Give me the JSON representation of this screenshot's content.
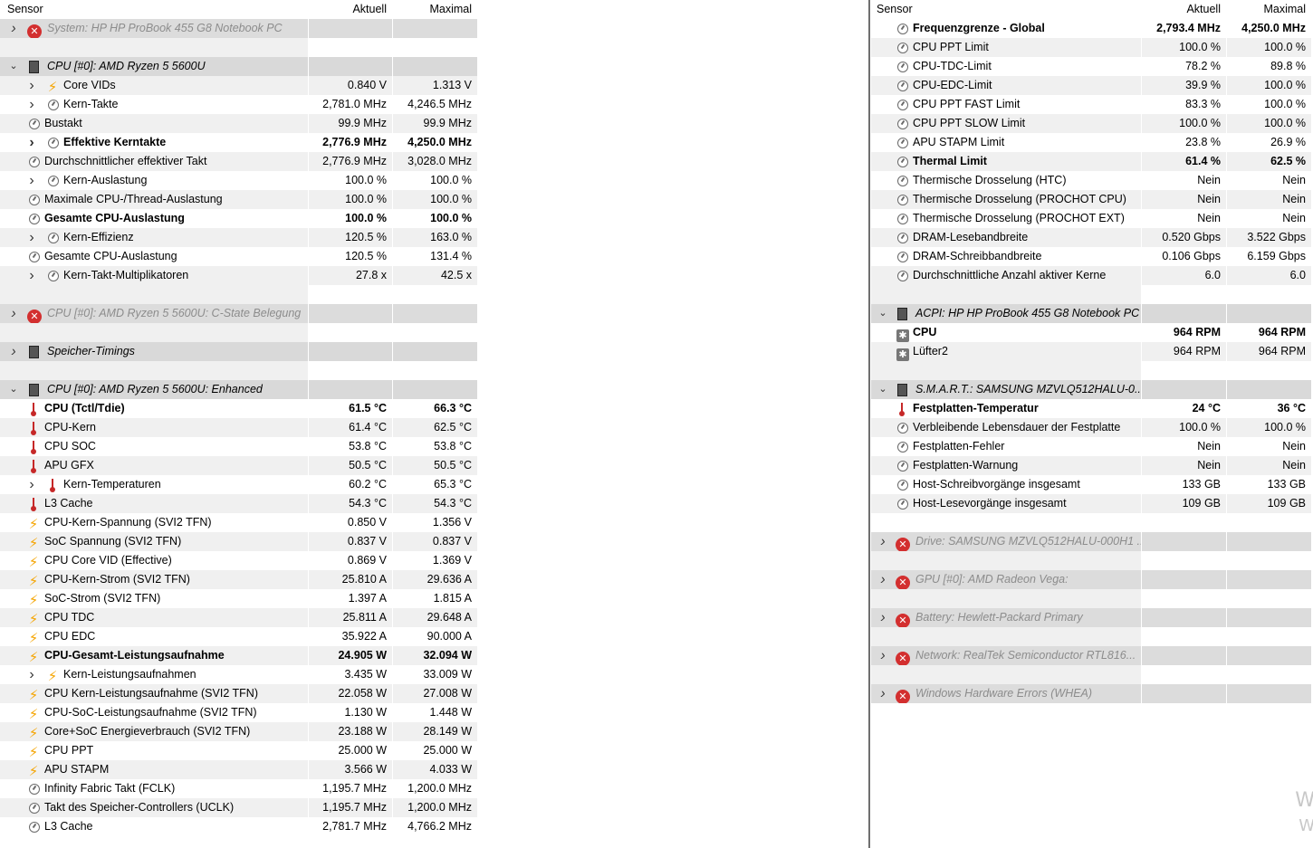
{
  "headers": {
    "sensor": "Sensor",
    "current": "Aktuell",
    "max": "Maximal"
  },
  "colors": {
    "group_bg": "#d9d9d9",
    "alt_bg": "#f0f0f0",
    "error": "#d32f2f",
    "bolt": "#f5a400",
    "therm": "#c62828"
  },
  "left_rows": [
    {
      "kind": "group",
      "err": true,
      "arrow": "right",
      "icon": "error-icon",
      "label": "System: HP HP ProBook 455 G8 Notebook PC"
    },
    {
      "kind": "blank"
    },
    {
      "kind": "group",
      "arrow": "down",
      "icon": "chip-icon",
      "label": "CPU [#0]: AMD Ryzen 5 5600U"
    },
    {
      "kind": "item",
      "indent": 2,
      "arrow": "right",
      "icon": "bolt-icon",
      "label": "Core VIDs",
      "cur": "0.840 V",
      "max": "1.313 V"
    },
    {
      "kind": "item",
      "indent": 2,
      "arrow": "right",
      "icon": "gauge-icon",
      "label": "Kern-Takte",
      "cur": "2,781.0 MHz",
      "max": "4,246.5 MHz"
    },
    {
      "kind": "item",
      "indent": 1,
      "icon": "gauge-icon",
      "label": "Bustakt",
      "cur": "99.9 MHz",
      "max": "99.9 MHz"
    },
    {
      "kind": "item",
      "indent": 2,
      "arrow": "right",
      "icon": "gauge-icon",
      "label": "Effektive Kerntakte",
      "cur": "2,776.9 MHz",
      "max": "4,250.0 MHz",
      "bold": true
    },
    {
      "kind": "item",
      "indent": 1,
      "icon": "gauge-icon",
      "label": "Durchschnittlicher effektiver Takt",
      "cur": "2,776.9 MHz",
      "max": "3,028.0 MHz"
    },
    {
      "kind": "item",
      "indent": 2,
      "arrow": "right",
      "icon": "gauge-icon",
      "label": "Kern-Auslastung",
      "cur": "100.0 %",
      "max": "100.0 %"
    },
    {
      "kind": "item",
      "indent": 1,
      "icon": "gauge-icon",
      "label": "Maximale CPU-/Thread-Auslastung",
      "cur": "100.0 %",
      "max": "100.0 %"
    },
    {
      "kind": "item",
      "indent": 1,
      "icon": "gauge-icon",
      "label": "Gesamte CPU-Auslastung",
      "cur": "100.0 %",
      "max": "100.0 %",
      "bold": true
    },
    {
      "kind": "item",
      "indent": 2,
      "arrow": "right",
      "icon": "gauge-icon",
      "label": "Kern-Effizienz",
      "cur": "120.5 %",
      "max": "163.0 %"
    },
    {
      "kind": "item",
      "indent": 1,
      "icon": "gauge-icon",
      "label": "Gesamte CPU-Auslastung",
      "cur": "120.5 %",
      "max": "131.4 %"
    },
    {
      "kind": "item",
      "indent": 2,
      "arrow": "right",
      "icon": "gauge-icon",
      "label": "Kern-Takt-Multiplikatoren",
      "cur": "27.8 x",
      "max": "42.5 x"
    },
    {
      "kind": "blank"
    },
    {
      "kind": "group",
      "err": true,
      "arrow": "right",
      "icon": "error-icon",
      "label": "CPU [#0]: AMD Ryzen 5 5600U: C-State Belegung"
    },
    {
      "kind": "blank"
    },
    {
      "kind": "group",
      "arrow": "right",
      "icon": "chip-icon",
      "label": "Speicher-Timings"
    },
    {
      "kind": "blank"
    },
    {
      "kind": "group",
      "arrow": "down",
      "icon": "chip-icon",
      "label": "CPU [#0]: AMD Ryzen 5 5600U: Enhanced"
    },
    {
      "kind": "item",
      "indent": 1,
      "icon": "therm-icon",
      "label": "CPU (Tctl/Tdie)",
      "cur": "61.5 °C",
      "max": "66.3 °C",
      "bold": true
    },
    {
      "kind": "item",
      "indent": 1,
      "icon": "therm-icon",
      "label": "CPU-Kern",
      "cur": "61.4 °C",
      "max": "62.5 °C"
    },
    {
      "kind": "item",
      "indent": 1,
      "icon": "therm-icon",
      "label": "CPU SOC",
      "cur": "53.8 °C",
      "max": "53.8 °C"
    },
    {
      "kind": "item",
      "indent": 1,
      "icon": "therm-icon",
      "label": "APU GFX",
      "cur": "50.5 °C",
      "max": "50.5 °C"
    },
    {
      "kind": "item",
      "indent": 2,
      "arrow": "right",
      "icon": "therm-icon",
      "label": "Kern-Temperaturen",
      "cur": "60.2 °C",
      "max": "65.3 °C"
    },
    {
      "kind": "item",
      "indent": 1,
      "icon": "therm-icon",
      "label": "L3 Cache",
      "cur": "54.3 °C",
      "max": "54.3 °C"
    },
    {
      "kind": "item",
      "indent": 1,
      "icon": "bolt-icon",
      "label": "CPU-Kern-Spannung (SVI2 TFN)",
      "cur": "0.850 V",
      "max": "1.356 V"
    },
    {
      "kind": "item",
      "indent": 1,
      "icon": "bolt-icon",
      "label": "SoC Spannung (SVI2 TFN)",
      "cur": "0.837 V",
      "max": "0.837 V"
    },
    {
      "kind": "item",
      "indent": 1,
      "icon": "bolt-icon",
      "label": "CPU Core VID (Effective)",
      "cur": "0.869 V",
      "max": "1.369 V"
    },
    {
      "kind": "item",
      "indent": 1,
      "icon": "bolt-icon",
      "label": "CPU-Kern-Strom (SVI2 TFN)",
      "cur": "25.810 A",
      "max": "29.636 A"
    },
    {
      "kind": "item",
      "indent": 1,
      "icon": "bolt-icon",
      "label": "SoC-Strom (SVI2 TFN)",
      "cur": "1.397 A",
      "max": "1.815 A"
    },
    {
      "kind": "item",
      "indent": 1,
      "icon": "bolt-icon",
      "label": "CPU TDC",
      "cur": "25.811 A",
      "max": "29.648 A"
    },
    {
      "kind": "item",
      "indent": 1,
      "icon": "bolt-icon",
      "label": "CPU EDC",
      "cur": "35.922 A",
      "max": "90.000 A"
    },
    {
      "kind": "item",
      "indent": 1,
      "icon": "bolt-icon",
      "label": "CPU-Gesamt-Leistungsaufnahme",
      "cur": "24.905 W",
      "max": "32.094 W",
      "bold": true
    },
    {
      "kind": "item",
      "indent": 2,
      "arrow": "right",
      "icon": "bolt-icon",
      "label": "Kern-Leistungsaufnahmen",
      "cur": "3.435 W",
      "max": "33.009 W"
    },
    {
      "kind": "item",
      "indent": 1,
      "icon": "bolt-icon",
      "label": "CPU Kern-Leistungsaufnahme (SVI2 TFN)",
      "cur": "22.058 W",
      "max": "27.008 W"
    },
    {
      "kind": "item",
      "indent": 1,
      "icon": "bolt-icon",
      "label": "CPU-SoC-Leistungsaufnahme (SVI2 TFN)",
      "cur": "1.130 W",
      "max": "1.448 W"
    },
    {
      "kind": "item",
      "indent": 1,
      "icon": "bolt-icon",
      "label": "Core+SoC Energieverbrauch (SVI2 TFN)",
      "cur": "23.188 W",
      "max": "28.149 W"
    },
    {
      "kind": "item",
      "indent": 1,
      "icon": "bolt-icon",
      "label": "CPU PPT",
      "cur": "25.000 W",
      "max": "25.000 W"
    },
    {
      "kind": "item",
      "indent": 1,
      "icon": "bolt-icon",
      "label": "APU STAPM",
      "cur": "3.566 W",
      "max": "4.033 W"
    },
    {
      "kind": "item",
      "indent": 1,
      "icon": "gauge-icon",
      "label": "Infinity Fabric Takt (FCLK)",
      "cur": "1,195.7 MHz",
      "max": "1,200.0 MHz"
    },
    {
      "kind": "item",
      "indent": 1,
      "icon": "gauge-icon",
      "label": "Takt des Speicher-Controllers (UCLK)",
      "cur": "1,195.7 MHz",
      "max": "1,200.0 MHz"
    },
    {
      "kind": "item",
      "indent": 1,
      "icon": "gauge-icon",
      "label": "L3 Cache",
      "cur": "2,781.7 MHz",
      "max": "4,766.2 MHz"
    }
  ],
  "right_rows": [
    {
      "kind": "item",
      "indent": 1,
      "icon": "gauge-icon",
      "label": "Frequenzgrenze - Global",
      "cur": "2,793.4 MHz",
      "max": "4,250.0 MHz",
      "bold": true
    },
    {
      "kind": "item",
      "indent": 1,
      "icon": "gauge-icon",
      "label": "CPU PPT Limit",
      "cur": "100.0 %",
      "max": "100.0 %"
    },
    {
      "kind": "item",
      "indent": 1,
      "icon": "gauge-icon",
      "label": "CPU-TDC-Limit",
      "cur": "78.2 %",
      "max": "89.8 %"
    },
    {
      "kind": "item",
      "indent": 1,
      "icon": "gauge-icon",
      "label": "CPU-EDC-Limit",
      "cur": "39.9 %",
      "max": "100.0 %"
    },
    {
      "kind": "item",
      "indent": 1,
      "icon": "gauge-icon",
      "label": "CPU PPT FAST Limit",
      "cur": "83.3 %",
      "max": "100.0 %"
    },
    {
      "kind": "item",
      "indent": 1,
      "icon": "gauge-icon",
      "label": "CPU PPT SLOW Limit",
      "cur": "100.0 %",
      "max": "100.0 %"
    },
    {
      "kind": "item",
      "indent": 1,
      "icon": "gauge-icon",
      "label": "APU STAPM Limit",
      "cur": "23.8 %",
      "max": "26.9 %"
    },
    {
      "kind": "item",
      "indent": 1,
      "icon": "gauge-icon",
      "label": "Thermal Limit",
      "cur": "61.4 %",
      "max": "62.5 %",
      "bold": true
    },
    {
      "kind": "item",
      "indent": 1,
      "icon": "gauge-icon",
      "label": "Thermische Drosselung (HTC)",
      "cur": "Nein",
      "max": "Nein"
    },
    {
      "kind": "item",
      "indent": 1,
      "icon": "gauge-icon",
      "label": "Thermische Drosselung (PROCHOT CPU)",
      "cur": "Nein",
      "max": "Nein"
    },
    {
      "kind": "item",
      "indent": 1,
      "icon": "gauge-icon",
      "label": "Thermische Drosselung (PROCHOT EXT)",
      "cur": "Nein",
      "max": "Nein"
    },
    {
      "kind": "item",
      "indent": 1,
      "icon": "gauge-icon",
      "label": "DRAM-Lesebandbreite",
      "cur": "0.520 Gbps",
      "max": "3.522 Gbps"
    },
    {
      "kind": "item",
      "indent": 1,
      "icon": "gauge-icon",
      "label": "DRAM-Schreibbandbreite",
      "cur": "0.106 Gbps",
      "max": "6.159 Gbps"
    },
    {
      "kind": "item",
      "indent": 1,
      "icon": "gauge-icon",
      "label": "Durchschnittliche Anzahl aktiver Kerne",
      "cur": "6.0",
      "max": "6.0"
    },
    {
      "kind": "blank"
    },
    {
      "kind": "group",
      "arrow": "down",
      "icon": "chip-icon",
      "label": "ACPI: HP HP ProBook 455 G8 Notebook PC"
    },
    {
      "kind": "item",
      "indent": 1,
      "icon": "fan-icon",
      "label": "CPU",
      "cur": "964 RPM",
      "max": "964 RPM",
      "bold": true
    },
    {
      "kind": "item",
      "indent": 1,
      "icon": "fan-icon",
      "label": "Lüfter2",
      "cur": "964 RPM",
      "max": "964 RPM"
    },
    {
      "kind": "blank"
    },
    {
      "kind": "group",
      "arrow": "down",
      "icon": "chip-icon",
      "label": "S.M.A.R.T.: SAMSUNG MZVLQ512HALU-0..."
    },
    {
      "kind": "item",
      "indent": 1,
      "icon": "therm-icon",
      "label": "Festplatten-Temperatur",
      "cur": "24 °C",
      "max": "36 °C",
      "bold": true
    },
    {
      "kind": "item",
      "indent": 1,
      "icon": "gauge-icon",
      "label": "Verbleibende Lebensdauer der Festplatte",
      "cur": "100.0 %",
      "max": "100.0 %"
    },
    {
      "kind": "item",
      "indent": 1,
      "icon": "gauge-icon",
      "label": "Festplatten-Fehler",
      "cur": "Nein",
      "max": "Nein"
    },
    {
      "kind": "item",
      "indent": 1,
      "icon": "gauge-icon",
      "label": "Festplatten-Warnung",
      "cur": "Nein",
      "max": "Nein"
    },
    {
      "kind": "item",
      "indent": 1,
      "icon": "gauge-icon",
      "label": "Host-Schreibvorgänge insgesamt",
      "cur": "133 GB",
      "max": "133 GB"
    },
    {
      "kind": "item",
      "indent": 1,
      "icon": "gauge-icon",
      "label": "Host-Lesevorgänge insgesamt",
      "cur": "109 GB",
      "max": "109 GB"
    },
    {
      "kind": "blank",
      "white": true
    },
    {
      "kind": "group",
      "err": true,
      "arrow": "right",
      "icon": "error-icon",
      "label": "Drive: SAMSUNG MZVLQ512HALU-000H1 ..."
    },
    {
      "kind": "blank"
    },
    {
      "kind": "group",
      "err": true,
      "arrow": "right",
      "icon": "error-icon",
      "label": "GPU [#0]: AMD Radeon Vega:"
    },
    {
      "kind": "blank"
    },
    {
      "kind": "group",
      "err": true,
      "arrow": "right",
      "icon": "error-icon",
      "label": "Battery: Hewlett-Packard Primary"
    },
    {
      "kind": "blank"
    },
    {
      "kind": "group",
      "err": true,
      "arrow": "right",
      "icon": "error-icon",
      "label": "Network: RealTek Semiconductor RTL816..."
    },
    {
      "kind": "blank"
    },
    {
      "kind": "group",
      "err": true,
      "arrow": "right",
      "icon": "error-icon",
      "label": "Windows Hardware Errors (WHEA)"
    }
  ]
}
